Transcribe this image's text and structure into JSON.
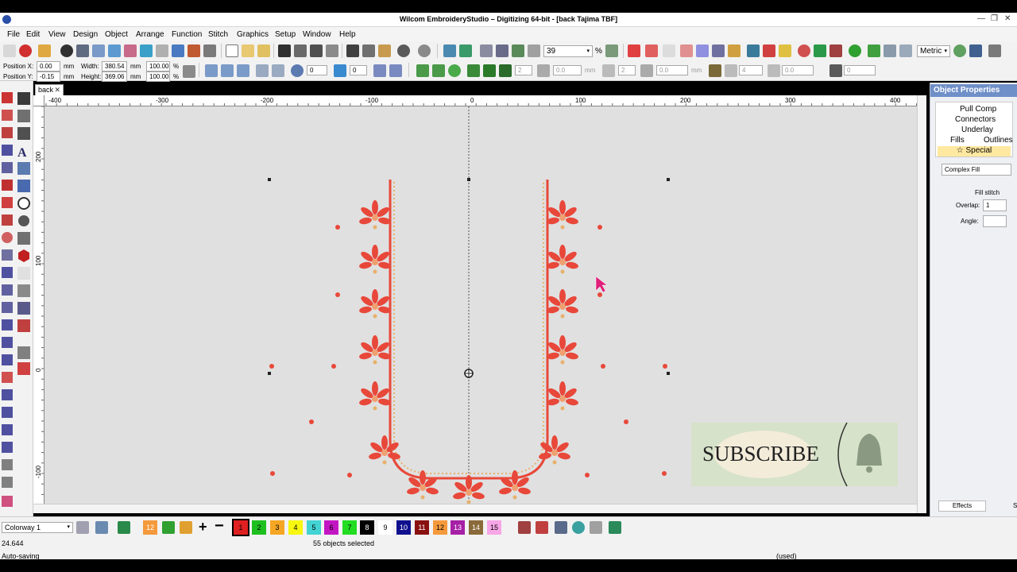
{
  "window": {
    "title": "Wilcom EmbroideryStudio – Digitizing 64-bit - [back      Tajima TBF]"
  },
  "menu": [
    "File",
    "Edit",
    "View",
    "Design",
    "Object",
    "Arrange",
    "Function",
    "Stitch",
    "Graphics",
    "Setup",
    "Window",
    "Help"
  ],
  "toolbar": {
    "zoom": "39",
    "zoom_unit": "%",
    "units": "Metric",
    "position_x_label": "Position X:",
    "position_x": "0.00",
    "position_y_label": "Position Y:",
    "position_y": "-0.15",
    "unit_mm": "mm",
    "width_label": "Width:",
    "width": "380.54",
    "height_label": "Height:",
    "height": "369.06",
    "scale_w": "100.00",
    "scale_h": "100.00",
    "pct": "%",
    "rotate_value": "0",
    "mirror_value": "0",
    "spacing_a": "2",
    "spacing_b": "0.0",
    "spacing_c": "2",
    "spacing_d": "0.0",
    "spacing_e": "4",
    "spacing_f": "0.0",
    "spacing_g": "0"
  },
  "document": {
    "tab": "back"
  },
  "ruler": {
    "x_ticks": [
      "-400",
      "-300",
      "-200",
      "-100",
      "0",
      "100",
      "200",
      "300",
      "400"
    ],
    "y_ticks": [
      "200",
      "100",
      "0",
      "-100"
    ]
  },
  "overlay": {
    "subscribe_text": "SUBSCRIBE"
  },
  "properties": {
    "title": "Object Properties",
    "tabs": [
      "Pull Comp",
      "Connectors",
      "Underlay",
      "Fills",
      "Outlines",
      "Special"
    ],
    "selected_tab": "Special",
    "fill_type": "Complex Fill",
    "section": "Fill stitch",
    "overlap_label": "Overlap:",
    "overlap_value": "1",
    "angle_label": "Angle:",
    "angle_value": "",
    "effects_label": "Effects",
    "s_label": "S"
  },
  "colorway": {
    "label": "Colorway 1",
    "swatches": [
      {
        "n": "1",
        "color": "#e02020"
      },
      {
        "n": "2",
        "color": "#1fbf1f"
      },
      {
        "n": "3",
        "color": "#f5a623"
      },
      {
        "n": "4",
        "color": "#f7f711"
      },
      {
        "n": "5",
        "color": "#43d3d3"
      },
      {
        "n": "6",
        "color": "#c316c3"
      },
      {
        "n": "7",
        "color": "#22dd22"
      },
      {
        "n": "8",
        "color": "#000000"
      },
      {
        "n": "9",
        "color": "#ffffff"
      },
      {
        "n": "10",
        "color": "#10108f"
      },
      {
        "n": "11",
        "color": "#8a1010"
      },
      {
        "n": "12",
        "color": "#f59a3c"
      },
      {
        "n": "13",
        "color": "#a620a6"
      },
      {
        "n": "14",
        "color": "#8a6a3a"
      },
      {
        "n": "15",
        "color": "#f7a6e6"
      }
    ],
    "extra_swatch": "12"
  },
  "status": {
    "selection": "55 objects selected",
    "coord": "24.644",
    "saving": "Auto-saving",
    "used": "(used)"
  }
}
